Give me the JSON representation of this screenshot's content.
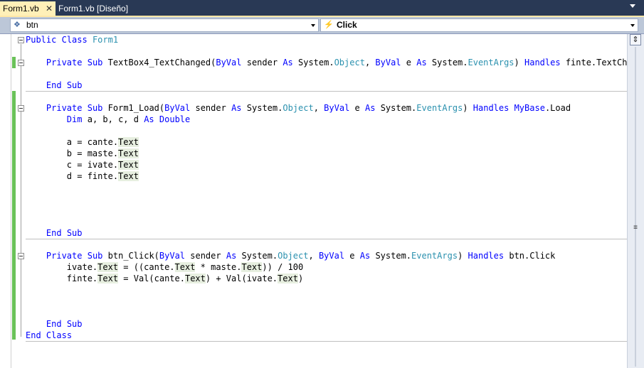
{
  "tabs": [
    {
      "label": "Form1.vb",
      "close": "✕"
    },
    {
      "label": "Form1.vb [Diseño]"
    }
  ],
  "nav": {
    "left_value": "btn",
    "left_icon": "object-icon",
    "right_value": "Click",
    "right_icon": "lightning-event-icon"
  },
  "code": {
    "l1": {
      "kw1": "Public",
      "kw2": "Class",
      "name": "Form1"
    },
    "l2": {
      "kw1": "Private",
      "kw2": "Sub",
      "sig": "TextBox4_TextChanged(",
      "bv1": "ByVal",
      "p1": "sender",
      "as1": "As",
      "ns1": "System.",
      "t1": "Object",
      "comma": ",",
      "bv2": "ByVal",
      "p2": "e",
      "as2": "As",
      "ns2": "System.",
      "t2": "EventArgs",
      "close": ")",
      "handles": "Handles",
      "target": "finte.TextChange"
    },
    "l3": {
      "kw1": "End",
      "kw2": "Sub"
    },
    "l4": {
      "kw1": "Private",
      "kw2": "Sub",
      "sig": "Form1_Load(",
      "bv1": "ByVal",
      "p1": "sender",
      "as1": "As",
      "ns1": "System.",
      "t1": "Object",
      "comma": ",",
      "bv2": "ByVal",
      "p2": "e",
      "as2": "As",
      "ns2": "System.",
      "t2": "EventArgs",
      "close": ")",
      "handles": "Handles",
      "mybase": "MyBase",
      "target": ".Load"
    },
    "l5": {
      "kw1": "Dim",
      "vars": "a, b, c, d",
      "as": "As",
      "type": "Double"
    },
    "l6": {
      "lhs": "a = cante.",
      "prop": "Text"
    },
    "l7": {
      "lhs": "b = maste.",
      "prop": "Text"
    },
    "l8": {
      "lhs": "c = ivate.",
      "prop": "Text"
    },
    "l9": {
      "lhs": "d = finte.",
      "prop": "Text"
    },
    "l10": {
      "kw1": "End",
      "kw2": "Sub"
    },
    "l11": {
      "kw1": "Private",
      "kw2": "Sub",
      "sig": "btn_Click(",
      "bv1": "ByVal",
      "p1": "sender",
      "as1": "As",
      "ns1": "System.",
      "t1": "Object",
      "comma": ",",
      "bv2": "ByVal",
      "p2": "e",
      "as2": "As",
      "ns2": "System.",
      "t2": "EventArgs",
      "close": ")",
      "handles": "Handles",
      "target": "btn.Click"
    },
    "l12": {
      "a": "ivate.",
      "p1": "Text",
      "b": " = ((cante.",
      "p2": "Text",
      "c": " * maste.",
      "p3": "Text",
      "d": ")) / 100"
    },
    "l13": {
      "a": "finte.",
      "p1": "Text",
      "b": " = Val(cante.",
      "p2": "Text",
      "c": ") + Val(ivate.",
      "p3": "Text",
      "d": ")"
    },
    "l14": {
      "kw1": "End",
      "kw2": "Sub"
    },
    "l15": {
      "kw1": "End",
      "kw2": "Class"
    }
  },
  "scrollbar": {
    "split_glyph": "⇕",
    "grip_glyph": "≡"
  },
  "colors": {
    "keyword": "#0000ff",
    "type": "#2b91af",
    "change_bar": "#6ac259",
    "active_tab": "#fff0b8",
    "chrome": "#293955"
  }
}
